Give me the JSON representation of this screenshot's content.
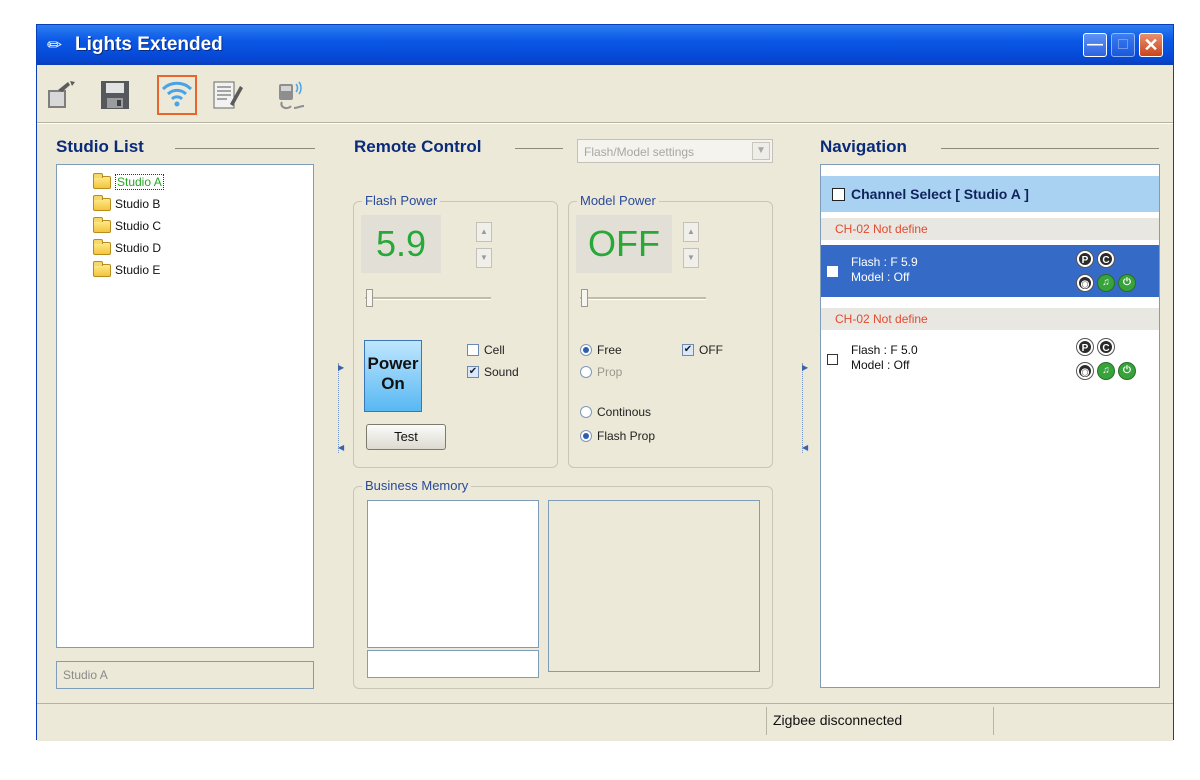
{
  "window": {
    "title": "Lights Extended"
  },
  "toolbar": [
    {
      "name": "open-icon"
    },
    {
      "name": "save-icon"
    },
    {
      "name": "wireless-icon",
      "active": true
    },
    {
      "name": "edit-notes-icon"
    },
    {
      "name": "remote-device-icon"
    }
  ],
  "studio_list": {
    "title": "Studio List",
    "items": [
      "Studio A",
      "Studio B",
      "Studio C",
      "Studio D",
      "Studio E"
    ],
    "selected": "Studio A",
    "name_field": "Studio A"
  },
  "remote_control": {
    "title": "Remote Control",
    "mode_select": "Flash/Model settings",
    "flash_power": {
      "label": "Flash Power",
      "value": "5.9"
    },
    "model_power": {
      "label": "Model Power",
      "value": "OFF"
    },
    "power_button": {
      "line1": "Power",
      "line2": "On"
    },
    "cell_label": "Cell",
    "cell_checked": false,
    "sound_label": "Sound",
    "sound_checked": true,
    "test_label": "Test",
    "free_label": "Free",
    "off_label": "OFF",
    "off_checked": true,
    "prop_label": "Prop",
    "continous_label": "Continous",
    "flash_prop_label": "Flash Prop",
    "business_memory_label": "Business Memory"
  },
  "navigation": {
    "title": "Navigation",
    "header": "Channel Select [ Studio A ]",
    "channels": [
      {
        "channel": "CH-02  Not define",
        "flash": "Flash : F 5.9",
        "model": "Model : Off",
        "selected": true
      },
      {
        "channel": "CH-02  Not define",
        "flash": "Flash : F 5.0",
        "model": "Model : Off",
        "selected": false
      }
    ]
  },
  "status": {
    "text": "Zigbee disconnected"
  },
  "colors": {
    "title_bar": "#0a58e6",
    "value_green": "#27a838",
    "channel_red": "#e24a30",
    "selected_row": "#356bc6"
  }
}
